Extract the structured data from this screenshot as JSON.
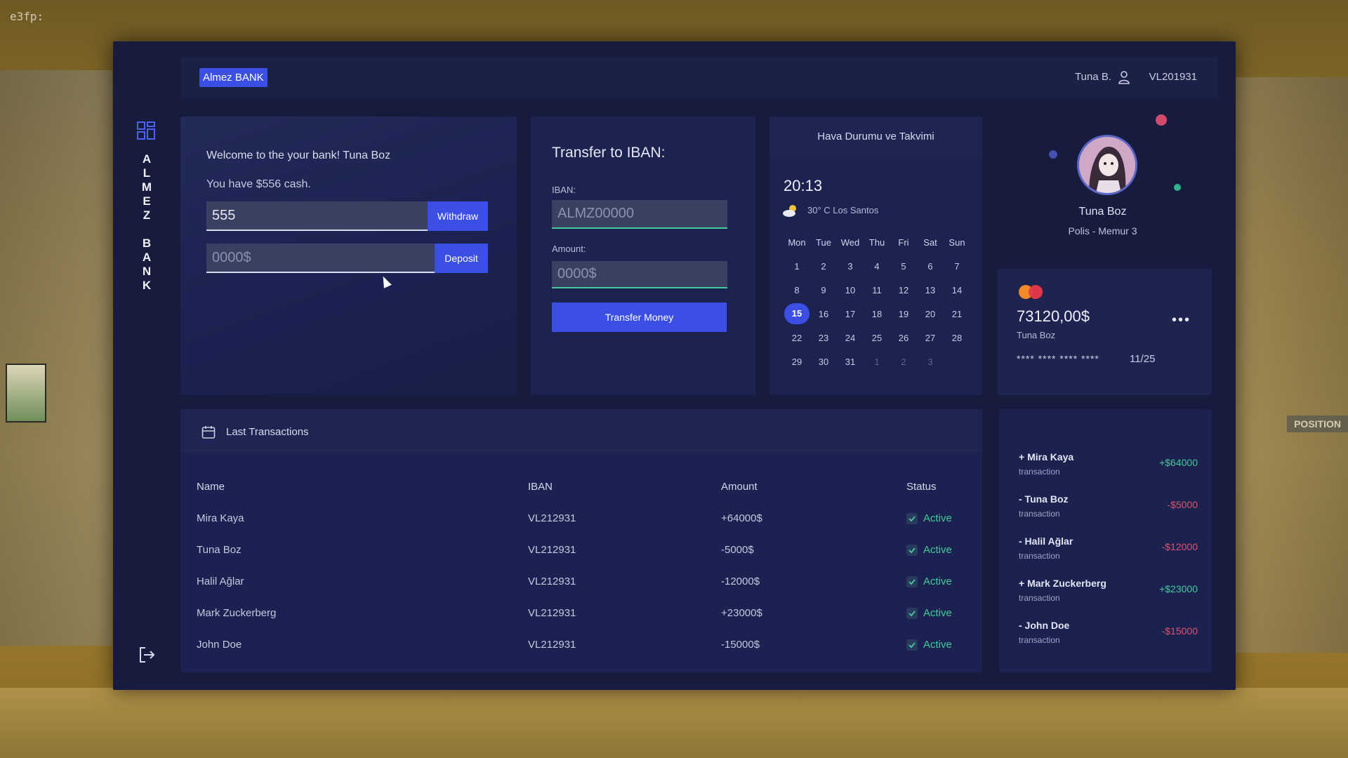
{
  "hud": {
    "text": "e3fp:"
  },
  "brand": {
    "badge": "Almez BANK",
    "side_letters": [
      "A",
      "L",
      "M",
      "E",
      "Z",
      "",
      "B",
      "A",
      "N",
      "K"
    ]
  },
  "header": {
    "user": "Tuna B.",
    "account": "VL201931"
  },
  "welcome": {
    "message": "Welcome to the your bank! Tuna Boz",
    "cash": "You have $556 cash.",
    "withdraw_value": "555",
    "withdraw_label": "Withdraw",
    "deposit_placeholder": "0000$",
    "deposit_label": "Deposit"
  },
  "transfer": {
    "title": "Transfer to IBAN:",
    "iban_label": "IBAN:",
    "iban_placeholder": "ALMZ00000",
    "amount_label": "Amount:",
    "amount_placeholder": "0000$",
    "button": "Transfer Money"
  },
  "calendar": {
    "title": "Hava Durumu ve Takvimi",
    "time": "20:13",
    "weather": "30° C Los Santos",
    "weekdays": [
      "Mon",
      "Tue",
      "Wed",
      "Thu",
      "Fri",
      "Sat",
      "Sun"
    ],
    "weeks": [
      [
        "1",
        "2",
        "3",
        "4",
        "5",
        "6",
        "7"
      ],
      [
        "8",
        "9",
        "10",
        "11",
        "12",
        "13",
        "14"
      ],
      [
        "15",
        "16",
        "17",
        "18",
        "19",
        "20",
        "21"
      ],
      [
        "22",
        "23",
        "24",
        "25",
        "26",
        "27",
        "28"
      ],
      [
        "29",
        "30",
        "31",
        "1",
        "2",
        "3",
        ""
      ]
    ],
    "today": "15"
  },
  "profile": {
    "name": "Tuna Boz",
    "role": "Polis - Memur 3"
  },
  "balance_card": {
    "amount": "73120,00$",
    "holder": "Tuna Boz",
    "number": "**** **** **** ****",
    "expiry": "11/25",
    "menu": "•••"
  },
  "transactions": {
    "title": "Last Transactions",
    "columns": [
      "Name",
      "IBAN",
      "Amount",
      "Status"
    ],
    "rows": [
      {
        "name": "Mira Kaya",
        "iban": "VL212931",
        "amount": "+64000$",
        "status": "Active"
      },
      {
        "name": "Tuna Boz",
        "iban": "VL212931",
        "amount": "-5000$",
        "status": "Active"
      },
      {
        "name": "Halil Ağlar",
        "iban": "VL212931",
        "amount": "-12000$",
        "status": "Active"
      },
      {
        "name": "Mark Zuckerberg",
        "iban": "VL212931",
        "amount": "+23000$",
        "status": "Active"
      },
      {
        "name": "John Doe",
        "iban": "VL212931",
        "amount": "-15000$",
        "status": "Active"
      }
    ]
  },
  "recent": [
    {
      "name": "+ Mira Kaya",
      "sub": "transaction",
      "amount": "+$64000",
      "type": "pos"
    },
    {
      "name": "- Tuna Boz",
      "sub": "transaction",
      "amount": "-$5000",
      "type": "neg"
    },
    {
      "name": "- Halil Ağlar",
      "sub": "transaction",
      "amount": "-$12000",
      "type": "neg"
    },
    {
      "name": "+ Mark Zuckerberg",
      "sub": "transaction",
      "amount": "+$23000",
      "type": "pos"
    },
    {
      "name": "- John Doe",
      "sub": "transaction",
      "amount": "-$15000",
      "type": "neg"
    }
  ],
  "colors": {
    "accent": "#3b4fe4",
    "positive": "#45c89a",
    "negative": "#e0516b",
    "panel": "#171b3d"
  }
}
